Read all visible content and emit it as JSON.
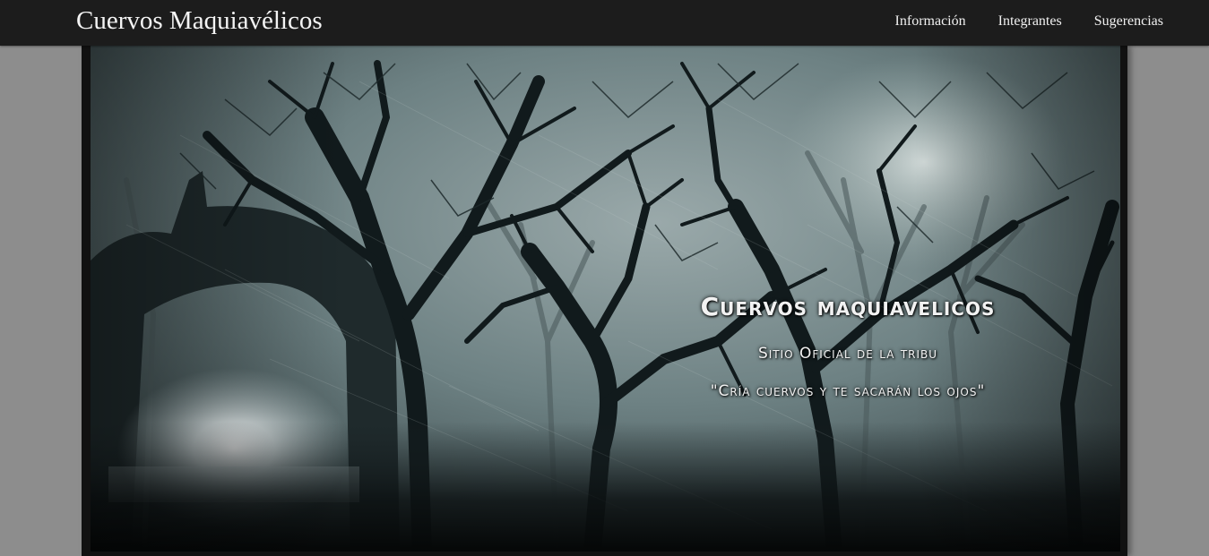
{
  "nav": {
    "brand": "Cuervos Maquiavélicos",
    "links": [
      "Información",
      "Integrantes",
      "Sugerencias"
    ]
  },
  "hero": {
    "image": "haunted-forest-with-stone-arch",
    "title": "Cuervos maquiavelicos",
    "subtitle": "Sitio Oficial de la tribu",
    "quote": "\"Cría cuervos y te sacarán los ojos\""
  },
  "colors": {
    "navbar": "#1c1c1c",
    "page_background": "#8d8d8d",
    "frame": "#111111"
  }
}
